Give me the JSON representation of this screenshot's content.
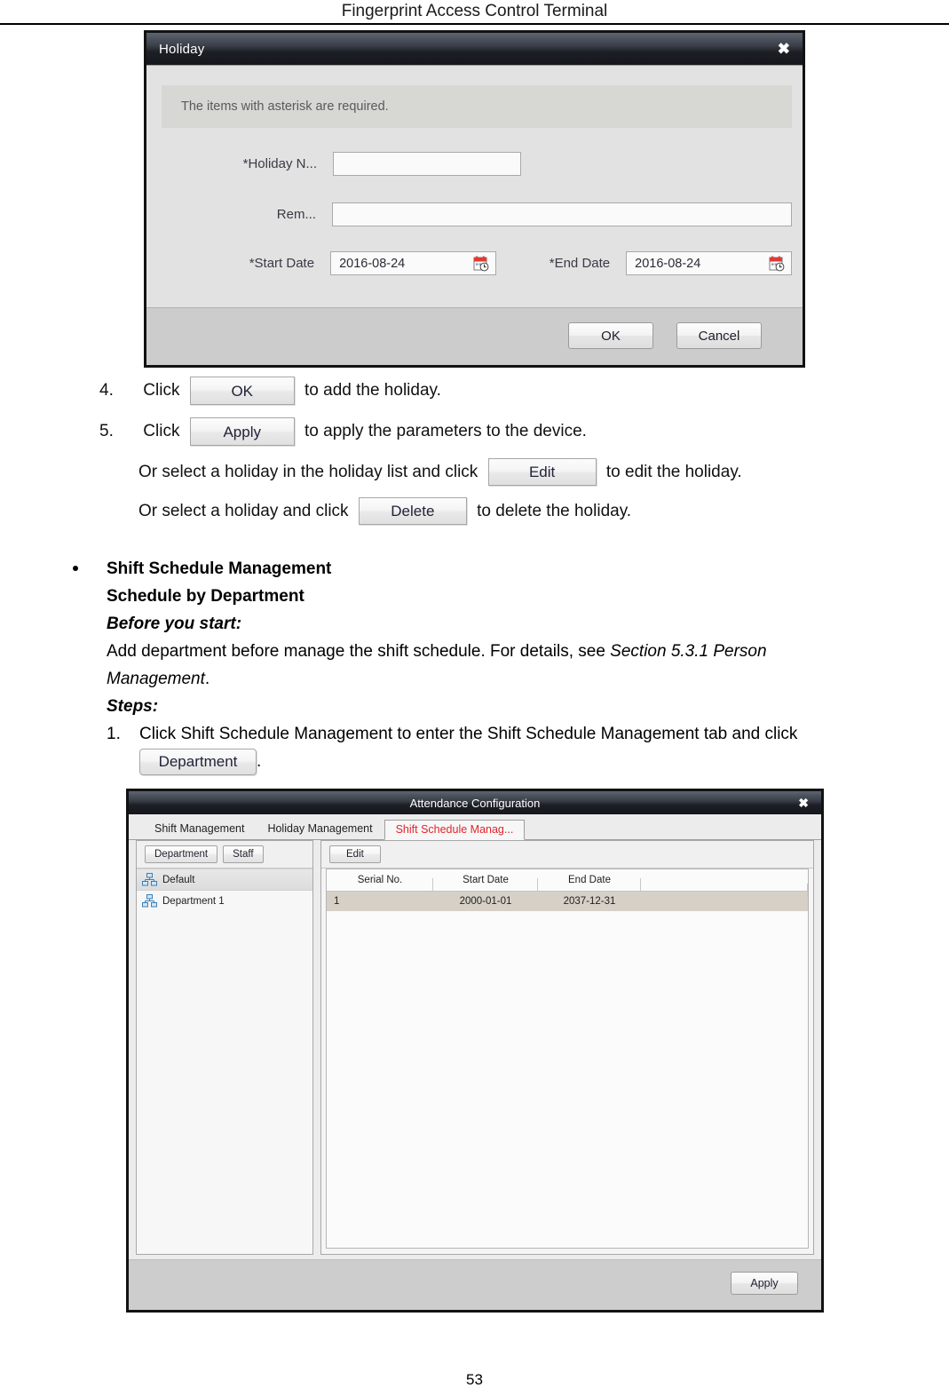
{
  "page": {
    "header_title": "Fingerprint Access Control Terminal",
    "page_number": "53"
  },
  "holiday_dialog": {
    "title": "Holiday",
    "close_icon": "close-icon",
    "notice": "The items with asterisk are required.",
    "fields": {
      "holiday_name_label": "*Holiday N...",
      "holiday_name_value": "",
      "remark_label": "Rem...",
      "remark_value": "",
      "start_date_label": "*Start Date",
      "start_date_value": "2016-08-24",
      "end_date_label": "*End Date",
      "end_date_value": "2016-08-24",
      "calendar_icon": "calendar-icon"
    },
    "buttons": {
      "ok": "OK",
      "cancel": "Cancel"
    }
  },
  "steps_holiday": {
    "step4": {
      "num": "4.",
      "pre": "Click",
      "button": "OK",
      "post": "to add the holiday."
    },
    "step5": {
      "num": "5.",
      "pre": "Click",
      "button": "Apply",
      "post": "to apply the parameters to the device.",
      "edit_line_pre": "Or select a holiday in the holiday list and click",
      "edit_button": "Edit",
      "edit_line_post": "to edit the holiday.",
      "delete_line_pre": "Or select a holiday and click",
      "delete_button": "Delete",
      "delete_line_post": "to delete the holiday."
    }
  },
  "shift_section": {
    "heading": "Shift Schedule Management",
    "subheading": "Schedule by Department",
    "before_you_start_label": "Before you start:",
    "before_you_start_text_1": "Add department before manage the shift schedule. For details, see ",
    "before_you_start_italic": "Section 5.3.1 Person",
    "before_you_start_italic_2": "Management",
    "before_you_start_text_2": ".",
    "steps_label": "Steps:",
    "step1_num": "1.",
    "step1_text": "Click Shift Schedule Management to enter the Shift Schedule Management tab and click",
    "step1_button": "Department",
    "step1_period": "."
  },
  "attendance_dialog": {
    "title": "Attendance Configuration",
    "close_icon": "close-icon",
    "tabs": [
      {
        "label": "Shift Management",
        "active": false
      },
      {
        "label": "Holiday Management",
        "active": false
      },
      {
        "label": "Shift Schedule Manag...",
        "active": true
      }
    ],
    "left_pane": {
      "buttons": [
        "Department",
        "Staff"
      ],
      "tree_items": [
        {
          "label": "Default",
          "selected": true,
          "icon": "org-tree-icon"
        },
        {
          "label": "Department 1",
          "selected": false,
          "icon": "org-tree-icon"
        }
      ]
    },
    "right_pane": {
      "toolbar_buttons": [
        "Edit"
      ],
      "columns": [
        "Serial No.",
        "Start Date",
        "End Date",
        ""
      ],
      "rows": [
        [
          "1",
          "2000-01-01",
          "2037-12-31",
          ""
        ]
      ]
    },
    "footer": {
      "apply": "Apply"
    }
  },
  "colors": {
    "tab_active_text": "#e0252b",
    "titlebar_dark": "#15171c",
    "row_selected": "#d6d0c7",
    "calendar_red": "#e03a36"
  }
}
